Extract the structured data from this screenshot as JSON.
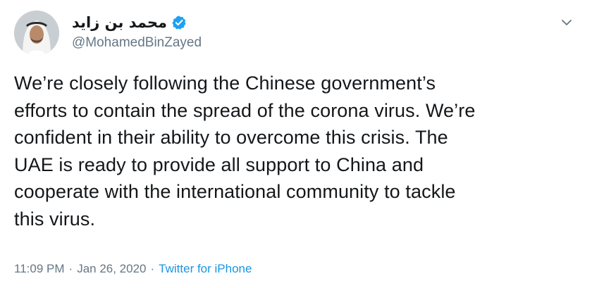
{
  "tweet": {
    "display_name": "محمد بن زايد",
    "handle": "@MohamedBinZayed",
    "verified": true,
    "text": "We’re closely following the Chinese government’s\nefforts to contain the spread of the corona virus. We’re\nconfident in their ability to overcome this crisis. The\nUAE is ready to provide all support to China and\ncooperate with the international community to tackle\nthis virus.",
    "time": "11:09 PM",
    "separator_1": "·",
    "date": "Jan 26, 2020",
    "separator_2": "·",
    "source": "Twitter for iPhone"
  },
  "icons": {
    "verified": "verified-badge-icon",
    "menu": "chevron-down-icon"
  },
  "colors": {
    "text": "#14171a",
    "secondary": "#657786",
    "link": "#1b95e0",
    "verified": "#1da1f2"
  }
}
